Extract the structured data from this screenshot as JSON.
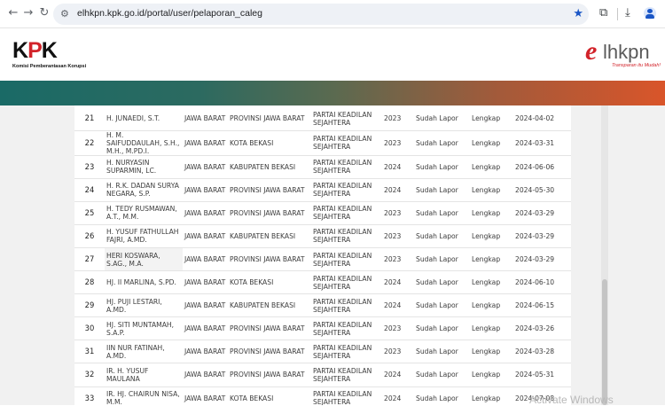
{
  "browser": {
    "back_icon": "←",
    "forward_icon": "→",
    "reload_icon": "↻",
    "site_settings_icon": "⚙",
    "url": "elhkpn.kpk.go.id/portal/user/pelaporan_caleg",
    "bookmark_icon": "★",
    "extensions_icon": "⧉",
    "download_icon": "⤓"
  },
  "header": {
    "kpk_logo": "KPK",
    "kpk_subtitle": "Komisi Pemberantasan Korupsi",
    "elhkpn_logo_e": "e",
    "elhkpn_logo_rest": "lhkpn",
    "elhkpn_tagline": "Transparan itu Mudah!",
    "accent_colors": [
      "#1a6a66",
      "#d9552a"
    ]
  },
  "table": {
    "rows": [
      {
        "no": "21",
        "nama": "H. JUNAEDI, S.T.",
        "provinsi": "JAWA BARAT",
        "dapil": "PROVINSI JAWA BARAT",
        "partai": "PARTAI KEADILAN SEJAHTERA",
        "tahun": "2023",
        "status": "Sudah Lapor",
        "kelengkapan": "Lengkap",
        "tanggal": "2024-04-02"
      },
      {
        "no": "22",
        "nama": "H. M. SAIFUDDAULAH, S.H., M.H., M.PD.I.",
        "provinsi": "JAWA BARAT",
        "dapil": "KOTA BEKASI",
        "partai": "PARTAI KEADILAN SEJAHTERA",
        "tahun": "2023",
        "status": "Sudah Lapor",
        "kelengkapan": "Lengkap",
        "tanggal": "2024-03-31"
      },
      {
        "no": "23",
        "nama": "H. NURYASIN SUPARMIN, LC.",
        "provinsi": "JAWA BARAT",
        "dapil": "KABUPATEN BEKASI",
        "partai": "PARTAI KEADILAN SEJAHTERA",
        "tahun": "2024",
        "status": "Sudah Lapor",
        "kelengkapan": "Lengkap",
        "tanggal": "2024-06-06"
      },
      {
        "no": "24",
        "nama": "H. R.K. DADAN SURYA NEGARA, S.P.",
        "provinsi": "JAWA BARAT",
        "dapil": "PROVINSI JAWA BARAT",
        "partai": "PARTAI KEADILAN SEJAHTERA",
        "tahun": "2024",
        "status": "Sudah Lapor",
        "kelengkapan": "Lengkap",
        "tanggal": "2024-05-30"
      },
      {
        "no": "25",
        "nama": "H. TEDY RUSMAWAN, A.T., M.M.",
        "provinsi": "JAWA BARAT",
        "dapil": "PROVINSI JAWA BARAT",
        "partai": "PARTAI KEADILAN SEJAHTERA",
        "tahun": "2023",
        "status": "Sudah Lapor",
        "kelengkapan": "Lengkap",
        "tanggal": "2024-03-29"
      },
      {
        "no": "26",
        "nama": "H. YUSUF FATHULLAH FAJRI, A.MD.",
        "provinsi": "JAWA BARAT",
        "dapil": "KABUPATEN BEKASI",
        "partai": "PARTAI KEADILAN SEJAHTERA",
        "tahun": "2023",
        "status": "Sudah Lapor",
        "kelengkapan": "Lengkap",
        "tanggal": "2024-03-29"
      },
      {
        "no": "27",
        "nama": "HERI KOSWARA, S.AG., M.A.",
        "provinsi": "JAWA BARAT",
        "dapil": "PROVINSI JAWA BARAT",
        "partai": "PARTAI KEADILAN SEJAHTERA",
        "tahun": "2023",
        "status": "Sudah Lapor",
        "kelengkapan": "Lengkap",
        "tanggal": "2024-03-29"
      },
      {
        "no": "28",
        "nama": "HJ. II MARLINA, S.PD.",
        "provinsi": "JAWA BARAT",
        "dapil": "KOTA BEKASI",
        "partai": "PARTAI KEADILAN SEJAHTERA",
        "tahun": "2024",
        "status": "Sudah Lapor",
        "kelengkapan": "Lengkap",
        "tanggal": "2024-06-10"
      },
      {
        "no": "29",
        "nama": "HJ. PUJI LESTARI, A.MD.",
        "provinsi": "JAWA BARAT",
        "dapil": "KABUPATEN BEKASI",
        "partai": "PARTAI KEADILAN SEJAHTERA",
        "tahun": "2024",
        "status": "Sudah Lapor",
        "kelengkapan": "Lengkap",
        "tanggal": "2024-06-15"
      },
      {
        "no": "30",
        "nama": "HJ. SITI MUNTAMAH, S.A.P.",
        "provinsi": "JAWA BARAT",
        "dapil": "PROVINSI JAWA BARAT",
        "partai": "PARTAI KEADILAN SEJAHTERA",
        "tahun": "2023",
        "status": "Sudah Lapor",
        "kelengkapan": "Lengkap",
        "tanggal": "2024-03-26"
      },
      {
        "no": "31",
        "nama": "IIN NUR FATINAH, A.MD.",
        "provinsi": "JAWA BARAT",
        "dapil": "PROVINSI JAWA BARAT",
        "partai": "PARTAI KEADILAN SEJAHTERA",
        "tahun": "2023",
        "status": "Sudah Lapor",
        "kelengkapan": "Lengkap",
        "tanggal": "2024-03-28"
      },
      {
        "no": "32",
        "nama": "IR. H. YUSUF MAULANA",
        "provinsi": "JAWA BARAT",
        "dapil": "PROVINSI JAWA BARAT",
        "partai": "PARTAI KEADILAN SEJAHTERA",
        "tahun": "2024",
        "status": "Sudah Lapor",
        "kelengkapan": "Lengkap",
        "tanggal": "2024-05-31"
      },
      {
        "no": "33",
        "nama": "IR. HJ. CHAIRUN NISA, M.M.",
        "provinsi": "JAWA BARAT",
        "dapil": "KOTA BEKASI",
        "partai": "PARTAI KEADILAN SEJAHTERA",
        "tahun": "2024",
        "status": "Sudah Lapor",
        "kelengkapan": "Lengkap",
        "tanggal": "2024-07-08"
      }
    ]
  },
  "watermark": "Activate Windows"
}
